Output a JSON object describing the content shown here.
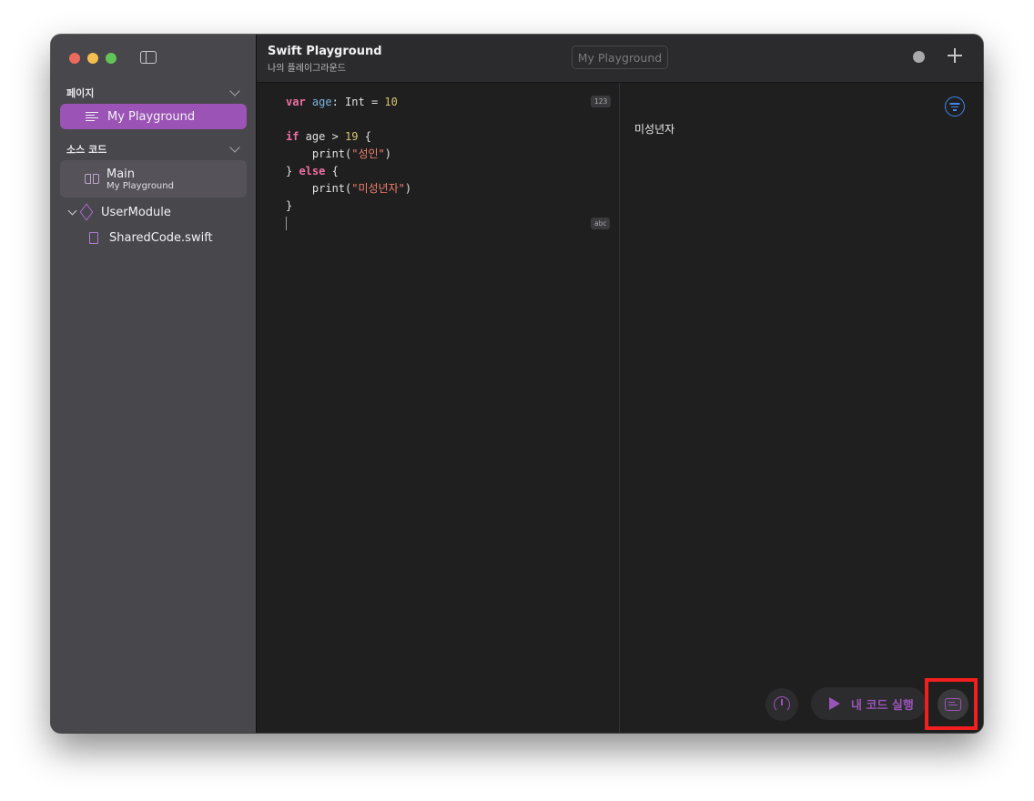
{
  "window": {
    "title": "Swift Playground",
    "subtitle": "나의 플레이그라운드"
  },
  "toolbar": {
    "tab_label": "My Playground"
  },
  "sidebar": {
    "pages_header": "페이지",
    "pages": [
      {
        "label": "My Playground",
        "selected": true
      }
    ],
    "source_header": "소스 코드",
    "source_items": [
      {
        "label": "Main",
        "sublabel": "My Playground"
      },
      {
        "label": "UserModule"
      },
      {
        "label": "SharedCode.swift"
      }
    ]
  },
  "editor": {
    "lines": {
      "l1": {
        "kw": "var",
        "id": "age",
        "rest": ": Int = ",
        "num": "10"
      },
      "l3": {
        "kw": "if",
        "rest": " age > ",
        "num": "19",
        "tail": " {"
      },
      "l4": {
        "pre": "    print(",
        "str": "\"성인\"",
        "post": ")"
      },
      "l5": {
        "pre": "} ",
        "kw": "else",
        "post": " {"
      },
      "l6": {
        "pre": "    print(",
        "str": "\"미성년자\"",
        "post": ")"
      },
      "l7": "}"
    },
    "badges": [
      "123",
      "abc"
    ]
  },
  "results": {
    "output": "미성년자"
  },
  "controls": {
    "run_label": "내 코드 실행"
  },
  "colors": {
    "accent_purple": "#9b53b5",
    "highlight_red": "#f21f1f",
    "filter_blue": "#3f86ef"
  }
}
